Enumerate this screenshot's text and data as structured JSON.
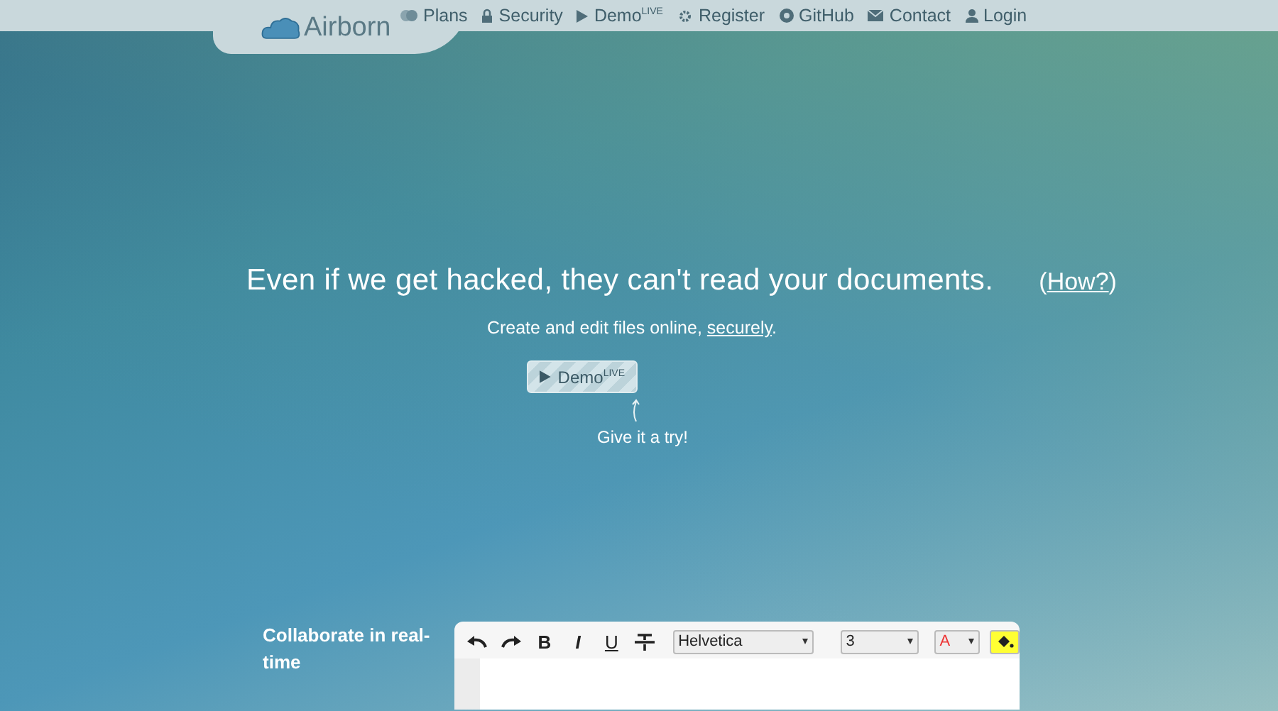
{
  "brand": "Airborn",
  "nav": [
    {
      "kind": "plans",
      "label": "Plans"
    },
    {
      "kind": "lock",
      "label": "Security"
    },
    {
      "kind": "play",
      "label": "Demo$^{LIVE}$"
    },
    {
      "kind": "gear",
      "label": "Register"
    },
    {
      "kind": "github",
      "label": "GitHub"
    },
    {
      "kind": "mail",
      "label": "Contact"
    },
    {
      "kind": "user",
      "label": "Login"
    }
  ],
  "hero": {
    "headline": "Even if we get hacked, they can't read your documents.",
    "how_link": "How?",
    "how_open": "(",
    "how_close": ")",
    "subtitle": "Create and edit files online,",
    "subtitle_link": "securely",
    "subtitle_end": ".",
    "demo_button": "Demo$^{LIVE}$",
    "hint": "Give it a try!"
  },
  "feature": {
    "title": "Collaborate in real-time"
  },
  "toolbar": [
    {
      "kind": "undo"
    },
    {
      "kind": "redo"
    },
    {
      "kind": "bold",
      "label": "B"
    },
    {
      "kind": "italic",
      "label": "I"
    },
    {
      "kind": "underline",
      "label": "U"
    },
    {
      "kind": "strike"
    },
    {
      "kind": "font",
      "value": "Helvetica"
    },
    {
      "kind": "size",
      "value": "3"
    },
    {
      "kind": "color",
      "label": "A"
    },
    {
      "kind": "highlight"
    }
  ]
}
